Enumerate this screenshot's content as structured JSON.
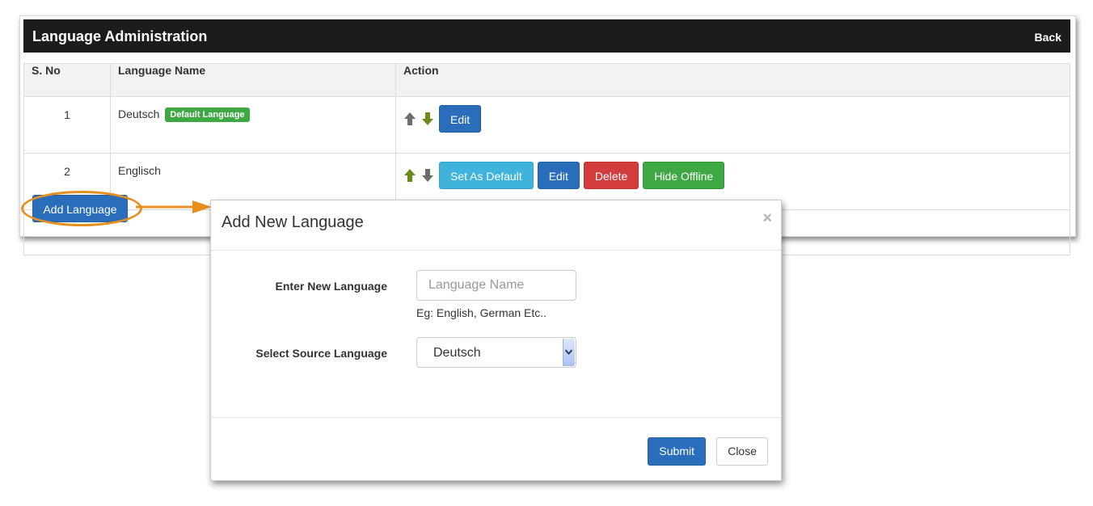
{
  "header": {
    "title": "Language Administration",
    "back_label": "Back"
  },
  "table": {
    "columns": [
      "S. No",
      "Language Name",
      "Action"
    ],
    "rows": [
      {
        "sno": "1",
        "name": "Deutsch",
        "badge": "Default Language",
        "edit_label": "Edit"
      },
      {
        "sno": "2",
        "name": "Englisch",
        "set_default_label": "Set As Default",
        "edit_label": "Edit",
        "delete_label": "Delete",
        "hide_offline_label": "Hide Offline"
      }
    ]
  },
  "add_button_label": "Add Language",
  "colors": {
    "header_bg": "#1c1c1c",
    "primary": "#2a6ebb",
    "info": "#3fb3dc",
    "danger": "#d33c3c",
    "success": "#3ea843",
    "arrow_active": "#6a8a1a",
    "arrow_inactive": "#6d6d6d",
    "callout": "#e5901f"
  },
  "icons": {
    "up": "arrow-up-icon",
    "down": "arrow-down-icon",
    "close": "close-icon",
    "select": "chevron-down-icon"
  },
  "modal": {
    "title": "Add New Language",
    "close_symbol": "×",
    "new_language_label": "Enter New Language",
    "new_language_placeholder": "Language Name",
    "new_language_value": "",
    "help_text": "Eg: English, German Etc..",
    "source_label": "Select Source Language",
    "source_selected": "Deutsch",
    "submit_label": "Submit",
    "close_label": "Close"
  }
}
